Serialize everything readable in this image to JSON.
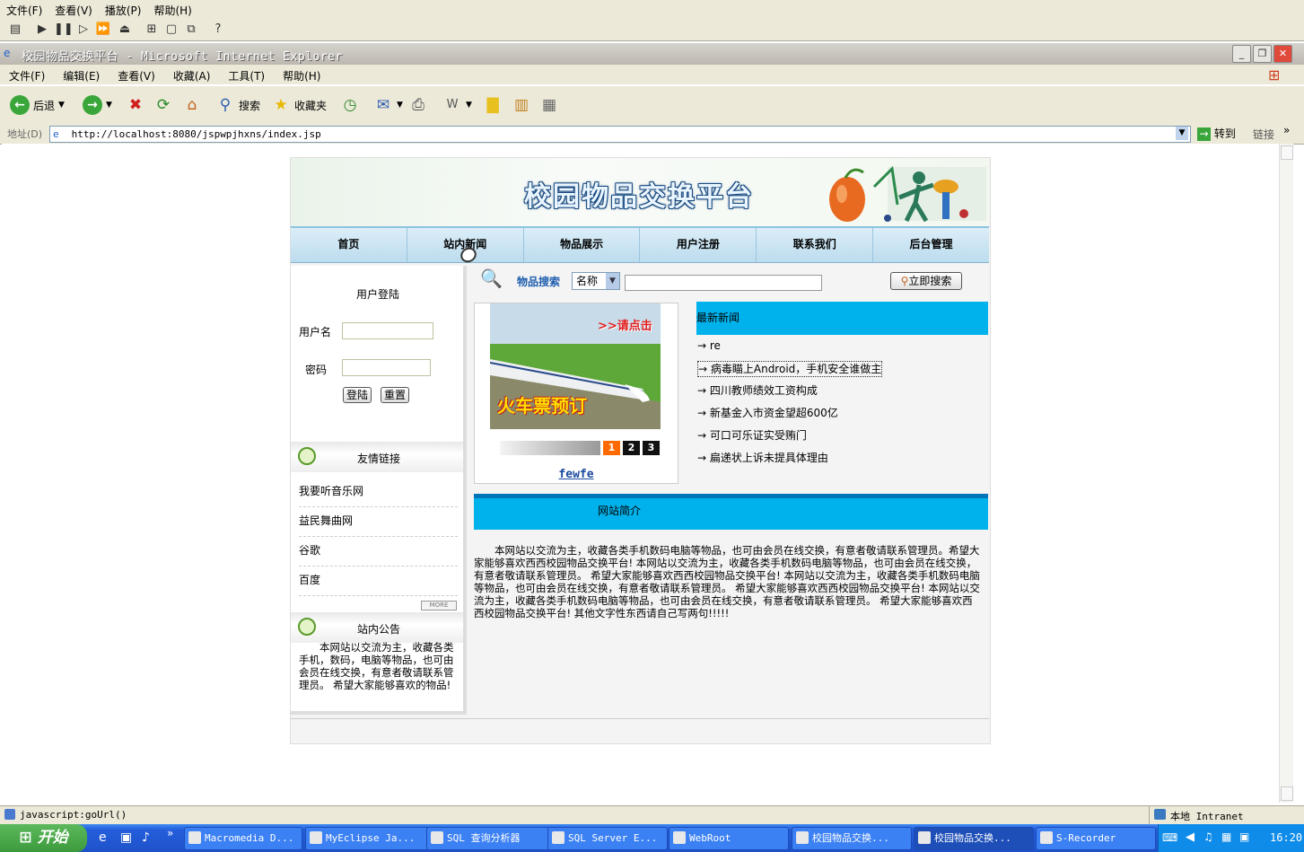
{
  "recorder": {
    "menu": [
      "文件(F)",
      "查看(V)",
      "播放(P)",
      "帮助(H)"
    ]
  },
  "ie": {
    "title": "校园物品交换平台 - Microsoft Internet Explorer",
    "menu": [
      "文件(F)",
      "编辑(E)",
      "查看(V)",
      "收藏(A)",
      "工具(T)",
      "帮助(H)"
    ],
    "toolbar": {
      "back": "后退",
      "search": "搜索",
      "favorites": "收藏夹"
    },
    "address_label": "地址(D)",
    "url": "http://localhost:8080/jspwpjhxns/index.jsp",
    "go": "转到",
    "links": "链接",
    "status": "javascript:goUrl()",
    "zone": "本地 Intranet"
  },
  "site": {
    "title": "校园物品交换平台",
    "nav": [
      "首页",
      "站内新闻",
      "物品展示",
      "用户注册",
      "联系我们",
      "后台管理"
    ],
    "login": {
      "title": "用户登陆",
      "username_label": "用户名",
      "password_label": "密码",
      "login_btn": "登陆",
      "reset_btn": "重置"
    },
    "friend_links": {
      "title": "友情链接",
      "items": [
        "我要听音乐网",
        "益民舞曲网",
        "谷歌",
        "百度"
      ],
      "more": "MORE"
    },
    "notice": {
      "title": "站内公告",
      "text": "本网站以交流为主，收藏各类手机，数码，电脑等物品，也可由会员在线交换，有意者敬请联系管理员。    希望大家能够喜欢的物品!"
    },
    "search": {
      "label": "物品搜索",
      "select_value": "名称",
      "button": "立即搜索"
    },
    "slideshow": {
      "image_text": "火车票预订",
      "image_tag": ">>请点击",
      "dots": [
        "1",
        "2",
        "3"
      ],
      "caption": "fewfe"
    },
    "news": {
      "title": "最新新闻",
      "items": [
        "re",
        "病毒瞄上Android，手机安全谁做主",
        "四川教师绩效工资构成",
        "新基金入市资金望超600亿",
        "可口可乐证实受贿门",
        "扁递状上诉未提具体理由"
      ]
    },
    "intro": {
      "title": "网站简介",
      "text": "本网站以交流为主，收藏各类手机数码电脑等物品，也可由会员在线交换，有意者敬请联系管理员。希望大家能够喜欢西西校园物品交换平台!      本网站以交流为主，收藏各类手机数码电脑等物品，也可由会员在线交换，有意者敬请联系管理员。      希望大家能够喜欢西西校园物品交换平台!      本网站以交流为主，收藏各类手机数码电脑等物品，也可由会员在线交换，有意者敬请联系管理员。      希望大家能够喜欢西西校园物品交换平台!      本网站以交流为主，收藏各类手机数码电脑等物品，也可由会员在线交换，有意者敬请联系管理员。      希望大家能够喜欢西西校园物品交换平台! 其他文字性东西请自己写两句!!!!!"
    }
  },
  "taskbar": {
    "start": "开始",
    "tasks": [
      "Macromedia D...",
      "MyEclipse Ja...",
      "SQL 查询分析器",
      "SQL Server E...",
      "WebRoot",
      "校园物品交换...",
      "校园物品交换...",
      "S-Recorder"
    ],
    "clock": "16:20"
  },
  "colors": {
    "accent_blue": "#00b2eb",
    "intro_border": "#0074b8",
    "nav_bg": "#cfe6f4"
  },
  "icons": [
    "ie-logo-icon",
    "back-icon",
    "forward-icon",
    "stop-icon",
    "refresh-icon",
    "home-icon",
    "search-icon",
    "favorites-icon",
    "history-icon",
    "mail-icon",
    "print-icon",
    "edit-icon",
    "folder-icon",
    "go-icon",
    "magnifier-icon",
    "leaf-icon",
    "start-icon"
  ]
}
